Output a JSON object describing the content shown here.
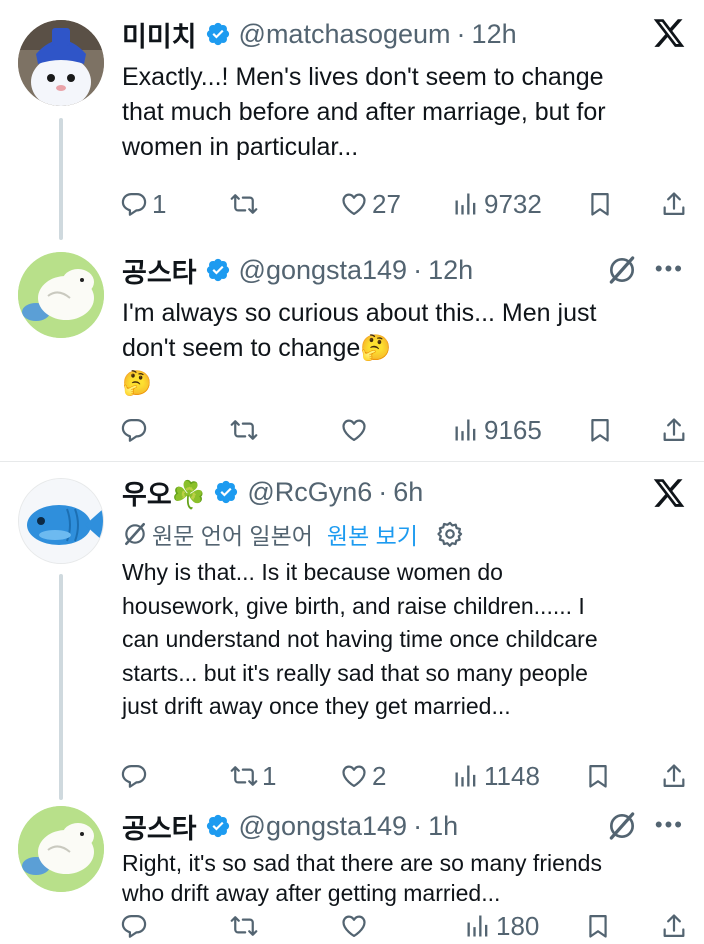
{
  "tweets": [
    {
      "name": "미미치",
      "handle": "@matchasogeum",
      "time": "12h",
      "text": "Exactly...! Men's lives don't seem to change that much before and after marriage, but for women in particular...",
      "reply_count": "1",
      "retweet_count": "",
      "like_count": "27",
      "view_count": "9732",
      "corner_icon": "x-logo-icon"
    },
    {
      "name": "공스타",
      "handle": "@gongsta149",
      "time": "12h",
      "text_line1": "I'm always so curious about this... Men just",
      "text_line2": "don't seem to change🤔",
      "text_line3": "🤔",
      "reply_count": "",
      "retweet_count": "",
      "like_count": "",
      "view_count": "9165",
      "corner_icon": "grok-icon"
    },
    {
      "name": "우오☘️",
      "handle": "@RcGyn6",
      "time": "6h",
      "translate_label": "원문 언어 일본어",
      "translate_link": "원본 보기",
      "text": "Why is that... Is it because women do housework, give birth, and raise children...... I can understand not having time once childcare starts... but it's really sad that so many people just drift away once they get married...",
      "reply_count": "",
      "retweet_count": "1",
      "like_count": "2",
      "view_count": "1148",
      "corner_icon": "x-logo-icon"
    },
    {
      "name": "공스타",
      "handle": "@gongsta149",
      "time": "1h",
      "text": "Right, it's so sad that there are so many friends who drift away after getting married...",
      "reply_count": "",
      "retweet_count": "",
      "like_count": "",
      "view_count": "180",
      "corner_icon": "grok-icon"
    }
  ],
  "colors": {
    "verified_blue": "#1d9bf0",
    "secondary_text": "#536471",
    "thread_line": "#cfd9de"
  }
}
